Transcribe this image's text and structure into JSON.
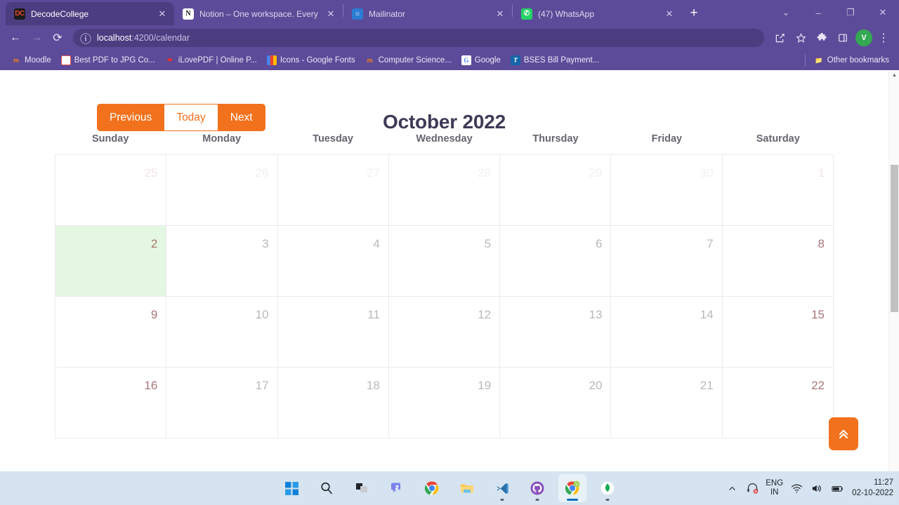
{
  "browser": {
    "tabs": [
      {
        "title": "DecodeCollege",
        "favicon": "decodecollege-favicon",
        "active": true
      },
      {
        "title": "Notion – One workspace. Every t",
        "favicon": "notion-favicon",
        "active": false
      },
      {
        "title": "Mailinator",
        "favicon": "mailinator-favicon",
        "active": false
      },
      {
        "title": "(47) WhatsApp",
        "favicon": "whatsapp-favicon",
        "active": false
      }
    ],
    "new_tab_label": "+",
    "window_controls": {
      "minimize": "–",
      "maximize": "❐",
      "close": "✕",
      "more": "⌄"
    },
    "nav": {
      "back": "←",
      "forward": "→",
      "reload": "⟳"
    },
    "address": {
      "host": "localhost",
      "path": ":4200/calendar",
      "full": "localhost:4200/calendar"
    },
    "profile_initial": "V",
    "bookmarks": [
      {
        "label": "Moodle",
        "icon": "moodle-icon"
      },
      {
        "label": "Best PDF to JPG Co...",
        "icon": "pdf-icon"
      },
      {
        "label": "iLovePDF | Online P...",
        "icon": "ilovepdf-icon"
      },
      {
        "label": "Icons - Google Fonts",
        "icon": "google-fonts-icon"
      },
      {
        "label": "Computer Science...",
        "icon": "moodle-icon"
      },
      {
        "label": "Google",
        "icon": "google-icon"
      },
      {
        "label": "BSES Bill Payment...",
        "icon": "bses-icon"
      }
    ],
    "other_bookmarks": "Other bookmarks"
  },
  "calendar": {
    "title": "October 2022",
    "buttons": {
      "previous": "Previous",
      "today": "Today",
      "next": "Next"
    },
    "day_headers": [
      "Sunday",
      "Monday",
      "Tuesday",
      "Wednesday",
      "Thursday",
      "Friday",
      "Saturday"
    ],
    "weeks": [
      [
        {
          "day": "25",
          "month": "other",
          "weekend": true,
          "today": false
        },
        {
          "day": "26",
          "month": "other",
          "weekend": false,
          "today": false
        },
        {
          "day": "27",
          "month": "other",
          "weekend": false,
          "today": false
        },
        {
          "day": "28",
          "month": "other",
          "weekend": false,
          "today": false
        },
        {
          "day": "29",
          "month": "other",
          "weekend": false,
          "today": false
        },
        {
          "day": "30",
          "month": "other",
          "weekend": false,
          "today": false
        },
        {
          "day": "1",
          "month": "other",
          "weekend": true,
          "today": false
        }
      ],
      [
        {
          "day": "2",
          "month": "current",
          "weekend": true,
          "today": true
        },
        {
          "day": "3",
          "month": "current",
          "weekend": false,
          "today": false
        },
        {
          "day": "4",
          "month": "current",
          "weekend": false,
          "today": false
        },
        {
          "day": "5",
          "month": "current",
          "weekend": false,
          "today": false
        },
        {
          "day": "6",
          "month": "current",
          "weekend": false,
          "today": false
        },
        {
          "day": "7",
          "month": "current",
          "weekend": false,
          "today": false
        },
        {
          "day": "8",
          "month": "current",
          "weekend": true,
          "today": false
        }
      ],
      [
        {
          "day": "9",
          "month": "current",
          "weekend": true,
          "today": false
        },
        {
          "day": "10",
          "month": "current",
          "weekend": false,
          "today": false
        },
        {
          "day": "11",
          "month": "current",
          "weekend": false,
          "today": false
        },
        {
          "day": "12",
          "month": "current",
          "weekend": false,
          "today": false
        },
        {
          "day": "13",
          "month": "current",
          "weekend": false,
          "today": false
        },
        {
          "day": "14",
          "month": "current",
          "weekend": false,
          "today": false
        },
        {
          "day": "15",
          "month": "current",
          "weekend": true,
          "today": false
        }
      ],
      [
        {
          "day": "16",
          "month": "current",
          "weekend": true,
          "today": false
        },
        {
          "day": "17",
          "month": "current",
          "weekend": false,
          "today": false
        },
        {
          "day": "18",
          "month": "current",
          "weekend": false,
          "today": false
        },
        {
          "day": "19",
          "month": "current",
          "weekend": false,
          "today": false
        },
        {
          "day": "20",
          "month": "current",
          "weekend": false,
          "today": false
        },
        {
          "day": "21",
          "month": "current",
          "weekend": false,
          "today": false
        },
        {
          "day": "22",
          "month": "current",
          "weekend": true,
          "today": false
        }
      ]
    ],
    "scroll_top_icon": "double-chevron-up-icon",
    "colors": {
      "accent": "#f2711c",
      "title": "#3d3b56",
      "weekday": "#b9b8bd",
      "weekend": "#a9757a",
      "today_background": "#e4f7e2"
    }
  },
  "taskbar": {
    "apps": [
      {
        "name": "start-button"
      },
      {
        "name": "search-button"
      },
      {
        "name": "task-view-button"
      },
      {
        "name": "teams-button"
      },
      {
        "name": "chrome-button"
      },
      {
        "name": "file-explorer-button"
      },
      {
        "name": "vscode-button"
      },
      {
        "name": "github-desktop-button"
      },
      {
        "name": "chrome-active-button"
      },
      {
        "name": "mongodb-compass-button"
      }
    ],
    "tray": {
      "language_primary": "ENG",
      "language_secondary": "IN",
      "time": "11:27",
      "date": "02-10-2022"
    }
  }
}
